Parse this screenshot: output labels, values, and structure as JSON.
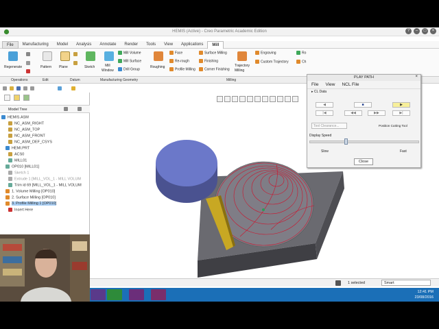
{
  "window": {
    "title": "HEMIS (Active) - Creo Parametric Academic Edition"
  },
  "menu_tabs": [
    "File",
    "Manufacturing",
    "Model",
    "Analysis",
    "Annotate",
    "Render",
    "Tools",
    "View",
    "Applications",
    "Mill"
  ],
  "active_tab": "Mill",
  "ribbon": {
    "operations": {
      "regenerate": "Regenerate"
    },
    "edit": {
      "pattern": "Pattern"
    },
    "datum": {
      "plane": "Plane",
      "sketch": "Sketch"
    },
    "mfg_geometry": {
      "mill_window": "Mill\nWindow",
      "mill_volume": "Mill Volume",
      "mill_surface": "Mill Surface",
      "drill_group": "Drill Group"
    },
    "milling": {
      "roughing": "Roughing",
      "face": "Face",
      "rerough": "Re-rough",
      "profile_milling": "Profile Milling",
      "surface_milling": "Surface Milling",
      "finishing": "Finishing",
      "corner_finishing": "Corner Finishing",
      "trajectory_milling": "Trajectory\nMilling",
      "engraving": "Engraving",
      "custom_trajectory": "Custom Trajectory",
      "ro": "Ro",
      "ch": "Ch"
    },
    "group_labels": [
      "Operations",
      "Edit",
      "Datum",
      "Manufacturing Geometry",
      "Milling"
    ]
  },
  "model_tree": {
    "header": "Model Tree",
    "items": [
      {
        "label": "HEMIS.ASM",
        "state": "normal"
      },
      {
        "label": "NC_ASM_RIGHT",
        "state": "normal"
      },
      {
        "label": "NC_ASM_TOP",
        "state": "normal"
      },
      {
        "label": "NC_ASM_FRONT",
        "state": "normal"
      },
      {
        "label": "NC_ASM_DEF_CSYS",
        "state": "normal"
      },
      {
        "label": "HEMI.PRT",
        "state": "normal"
      },
      {
        "label": "ACS0",
        "state": "normal"
      },
      {
        "label": "MILL01",
        "state": "normal"
      },
      {
        "label": "OP010 [MILL01]",
        "state": "normal"
      },
      {
        "label": "Sketch 1",
        "state": "faded"
      },
      {
        "label": "Extrude 1 [MILL_VOL_1 - MILL VOLUM",
        "state": "faded"
      },
      {
        "label": "Trim id 69 [MILL_VOL_1 - MILL VOLUM",
        "state": "normal"
      },
      {
        "label": "1. Volume Milling [OP010]",
        "state": "normal"
      },
      {
        "label": "2. Surface Milling [OP010]",
        "state": "normal"
      },
      {
        "label": "3. Profile Milling 1 [OP010]",
        "state": "selected"
      },
      {
        "label": "Insert Here",
        "state": "normal"
      }
    ]
  },
  "play_path": {
    "title": "PLAY PATH",
    "close_x": "×",
    "menu": [
      "File",
      "View",
      "NCL File"
    ],
    "cl_data": "CL Data",
    "tool_clearance": "Tool Clearance...",
    "position_cutting_tool": "Position Cutting Tool",
    "display_speed": "Display Speed",
    "slow": "Slow",
    "fast": "Fast",
    "speed": 0.33,
    "close": "Close"
  },
  "status": {
    "selected": "1 selected",
    "filter": "Smart"
  },
  "taskbar": {
    "time": "12:41 PM",
    "date": "23/08/2016"
  },
  "colors": {
    "accent": "#1b6fb7",
    "toolpath": "#d0102a",
    "stock": "#5a5a5f",
    "tool_body": "#6a77c9",
    "shank": "#d4b11f"
  }
}
